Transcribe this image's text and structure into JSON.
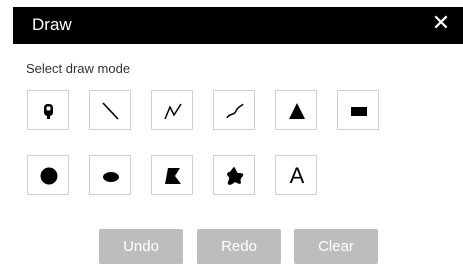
{
  "dialog": {
    "title": "Draw",
    "close_glyph": "✕"
  },
  "mode_label": "Select draw mode",
  "tools": [
    {
      "name": "point",
      "icon": "map-pin-icon"
    },
    {
      "name": "line",
      "icon": "line-icon"
    },
    {
      "name": "polyline",
      "icon": "polyline-icon"
    },
    {
      "name": "freehand-polyline",
      "icon": "freehand-line-icon"
    },
    {
      "name": "triangle",
      "icon": "triangle-icon"
    },
    {
      "name": "rectangle",
      "icon": "rectangle-icon"
    },
    {
      "name": "circle",
      "icon": "circle-icon"
    },
    {
      "name": "ellipse",
      "icon": "ellipse-icon"
    },
    {
      "name": "polygon",
      "icon": "polygon-icon"
    },
    {
      "name": "freehand-polygon",
      "icon": "freehand-polygon-icon"
    },
    {
      "name": "text",
      "icon": "text-icon",
      "glyph": "A"
    }
  ],
  "buttons": {
    "undo": "Undo",
    "redo": "Redo",
    "clear": "Clear"
  },
  "colors": {
    "header_bg": "#000000",
    "button_disabled_bg": "#bdbdbd",
    "tool_border": "#cfcfcf"
  }
}
